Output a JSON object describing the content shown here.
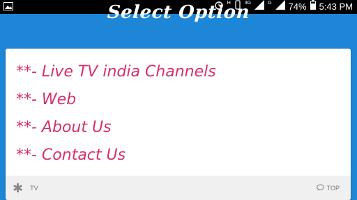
{
  "status_bar": {
    "network_label_1": "H",
    "network_label_2": "3G",
    "network_label_3": "G",
    "battery": "74%",
    "time": "5:43 PM"
  },
  "header": {
    "title": "Select Option"
  },
  "menu": {
    "items": [
      {
        "label": "**- Live TV india Channels"
      },
      {
        "label": "**- Web"
      },
      {
        "label": "**- About Us"
      },
      {
        "label": "**- Contact Us"
      }
    ]
  },
  "footer": {
    "left_label": "TV",
    "right_label": "TOP"
  }
}
